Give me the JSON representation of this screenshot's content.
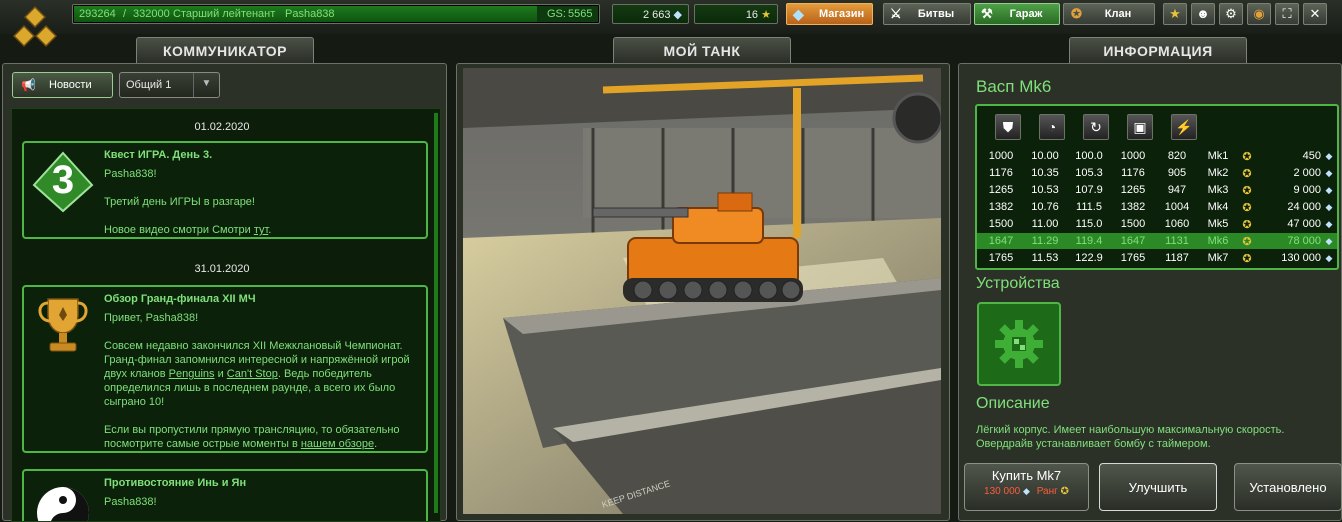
{
  "header": {
    "xp_current": "293264",
    "xp_sep": "/",
    "xp_total": "332000",
    "xp_progress": 0.883,
    "rank_name": "Старший лейтенант",
    "username": "Pasha838",
    "gs_label": "GS:",
    "gs_value": "5565",
    "crystals": "2 663",
    "stars": "16",
    "shop_label": "Магазин",
    "battles_label": "Битвы",
    "garage_label": "Гараж",
    "clan_label": "Клан"
  },
  "tabs": {
    "communicator": "КОММУНИКАТОР",
    "my_tank": "МОЙ ТАНК",
    "info": "ИНФОРМАЦИЯ"
  },
  "communicator": {
    "news_button": "Новости",
    "channel_select": "Общий 1",
    "items": [
      {
        "date": "01.02.2020",
        "badge": "3",
        "title": "Квест ИГРА. День 3.",
        "p1": "Pasha838!",
        "p2": "Третий день ИГРЫ в разгаре!",
        "p3_pre": "Новое видео смотри Смотри ",
        "p3_link": "тут",
        "p3_post": "."
      },
      {
        "date": "31.01.2020",
        "title": "Обзор Гранд-финала XII МЧ",
        "p1": "Привет, Pasha838!",
        "p2_a": "Совсем недавно закончился XII Межклановый Чемпионат. Гранд-финал запомнился интересной и напряжённой игрой двух кланов ",
        "p2_link1": "Penguins",
        "p2_and": " и ",
        "p2_link2": "Can't Stop",
        "p2_b": ". Ведь победитель определился лишь в последнем раунде, а всего их было сыграно 10!",
        "p3_pre": "Если вы пропустили прямую трансляцию, то обязательно посмотрите самые острые моменты в ",
        "p3_link": "нашем обзоре",
        "p3_post": "."
      },
      {
        "title": "Противостояние Инь и Ян",
        "p1": "Pasha838!"
      }
    ]
  },
  "tank_view": {
    "floor_text": "KEEP DISTANCE"
  },
  "info": {
    "title": "Васп Mk6",
    "stat_icons": [
      "armor-icon",
      "speed-icon",
      "turn-icon",
      "weight-icon",
      "power-icon"
    ],
    "rows": [
      {
        "a": "1000",
        "b": "10.00",
        "c": "100.0",
        "d": "1000",
        "e": "820",
        "mk": "Mk1",
        "price": "450"
      },
      {
        "a": "1176",
        "b": "10.35",
        "c": "105.3",
        "d": "1176",
        "e": "905",
        "mk": "Mk2",
        "price": "2 000"
      },
      {
        "a": "1265",
        "b": "10.53",
        "c": "107.9",
        "d": "1265",
        "e": "947",
        "mk": "Mk3",
        "price": "9 000"
      },
      {
        "a": "1382",
        "b": "10.76",
        "c": "111.5",
        "d": "1382",
        "e": "1004",
        "mk": "Mk4",
        "price": "24 000"
      },
      {
        "a": "1500",
        "b": "11.00",
        "c": "115.0",
        "d": "1500",
        "e": "1060",
        "mk": "Mk5",
        "price": "47 000"
      },
      {
        "a": "1647",
        "b": "11.29",
        "c": "119.4",
        "d": "1647",
        "e": "1131",
        "mk": "Mk6",
        "price": "78 000"
      },
      {
        "a": "1765",
        "b": "11.53",
        "c": "122.9",
        "d": "1765",
        "e": "1187",
        "mk": "Mk7",
        "price": "130 000"
      }
    ],
    "current_row": 5,
    "devices_title": "Устройства",
    "description_title": "Описание",
    "description": "Лёгкий корпус. Имеет наибольшую максимальную скорость. Овердрайв устанавливает бомбу с таймером.",
    "buy_label": "Купить Mk7",
    "buy_price": "130 000",
    "buy_rank_label": "Ранг",
    "upgrade_label": "Улучшить",
    "installed_label": "Установлено"
  },
  "colors": {
    "accent_green": "#7fe07a",
    "border_green": "#4fb545",
    "shop_orange": "#d98a30",
    "price_red": "#ff5a3a"
  }
}
